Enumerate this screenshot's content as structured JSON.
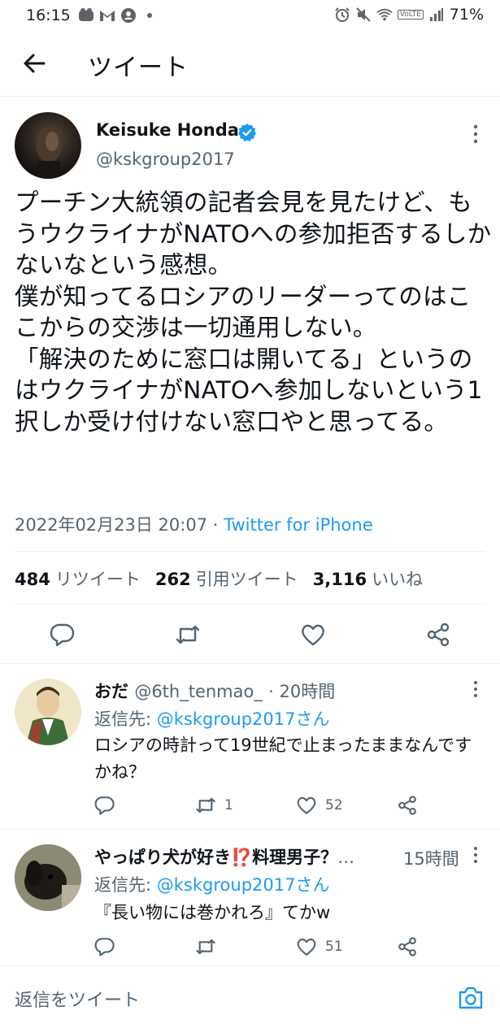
{
  "status_bar": {
    "time": "16:15",
    "battery": "71%",
    "volte": "VoLTE"
  },
  "header": {
    "title": "ツイート"
  },
  "tweet": {
    "author_name": "Keisuke Honda",
    "author_handle": "@kskgroup2017",
    "text": "プーチン大統領の記者会見を見たけど、もうウクライナがNATOへの参加拒否するしかないなという感想。\n僕が知ってるロシアのリーダーってのはここからの交渉は一切通用しない。\n「解決のために窓口は開いてる」というのはウクライナがNATOへ参加しないという1択しか受け付けない窓口やと思ってる。",
    "timestamp": "2022年02月23日 20:07",
    "separator": " · ",
    "source": "Twitter for iPhone",
    "retweets": "484",
    "retweets_label": "リツイート",
    "quotes": "262",
    "quotes_label": "引用ツイート",
    "likes": "3,116",
    "likes_label": "いいね"
  },
  "replies": [
    {
      "name": "おだ",
      "handle": "@6th_tenmao_",
      "time": "· 20時間",
      "reply_to_label": "返信先: ",
      "reply_to": "@kskgroup2017さん",
      "text": "ロシアの時計って19世紀で止まったままなんですかね？",
      "retweets": "1",
      "likes": "52"
    },
    {
      "name": "やっぱり犬が好き⁉️料理男子？",
      "handle": "…",
      "time": "15時間",
      "reply_to_label": "返信先: ",
      "reply_to": "@kskgroup2017さん",
      "text": "『長い物には巻かれろ』てかw",
      "retweets": "",
      "likes": "51"
    }
  ],
  "compose": {
    "placeholder": "返信をツイート"
  },
  "colors": {
    "accent": "#1d9bf0",
    "secondary": "#536471",
    "text": "#0f1419"
  }
}
